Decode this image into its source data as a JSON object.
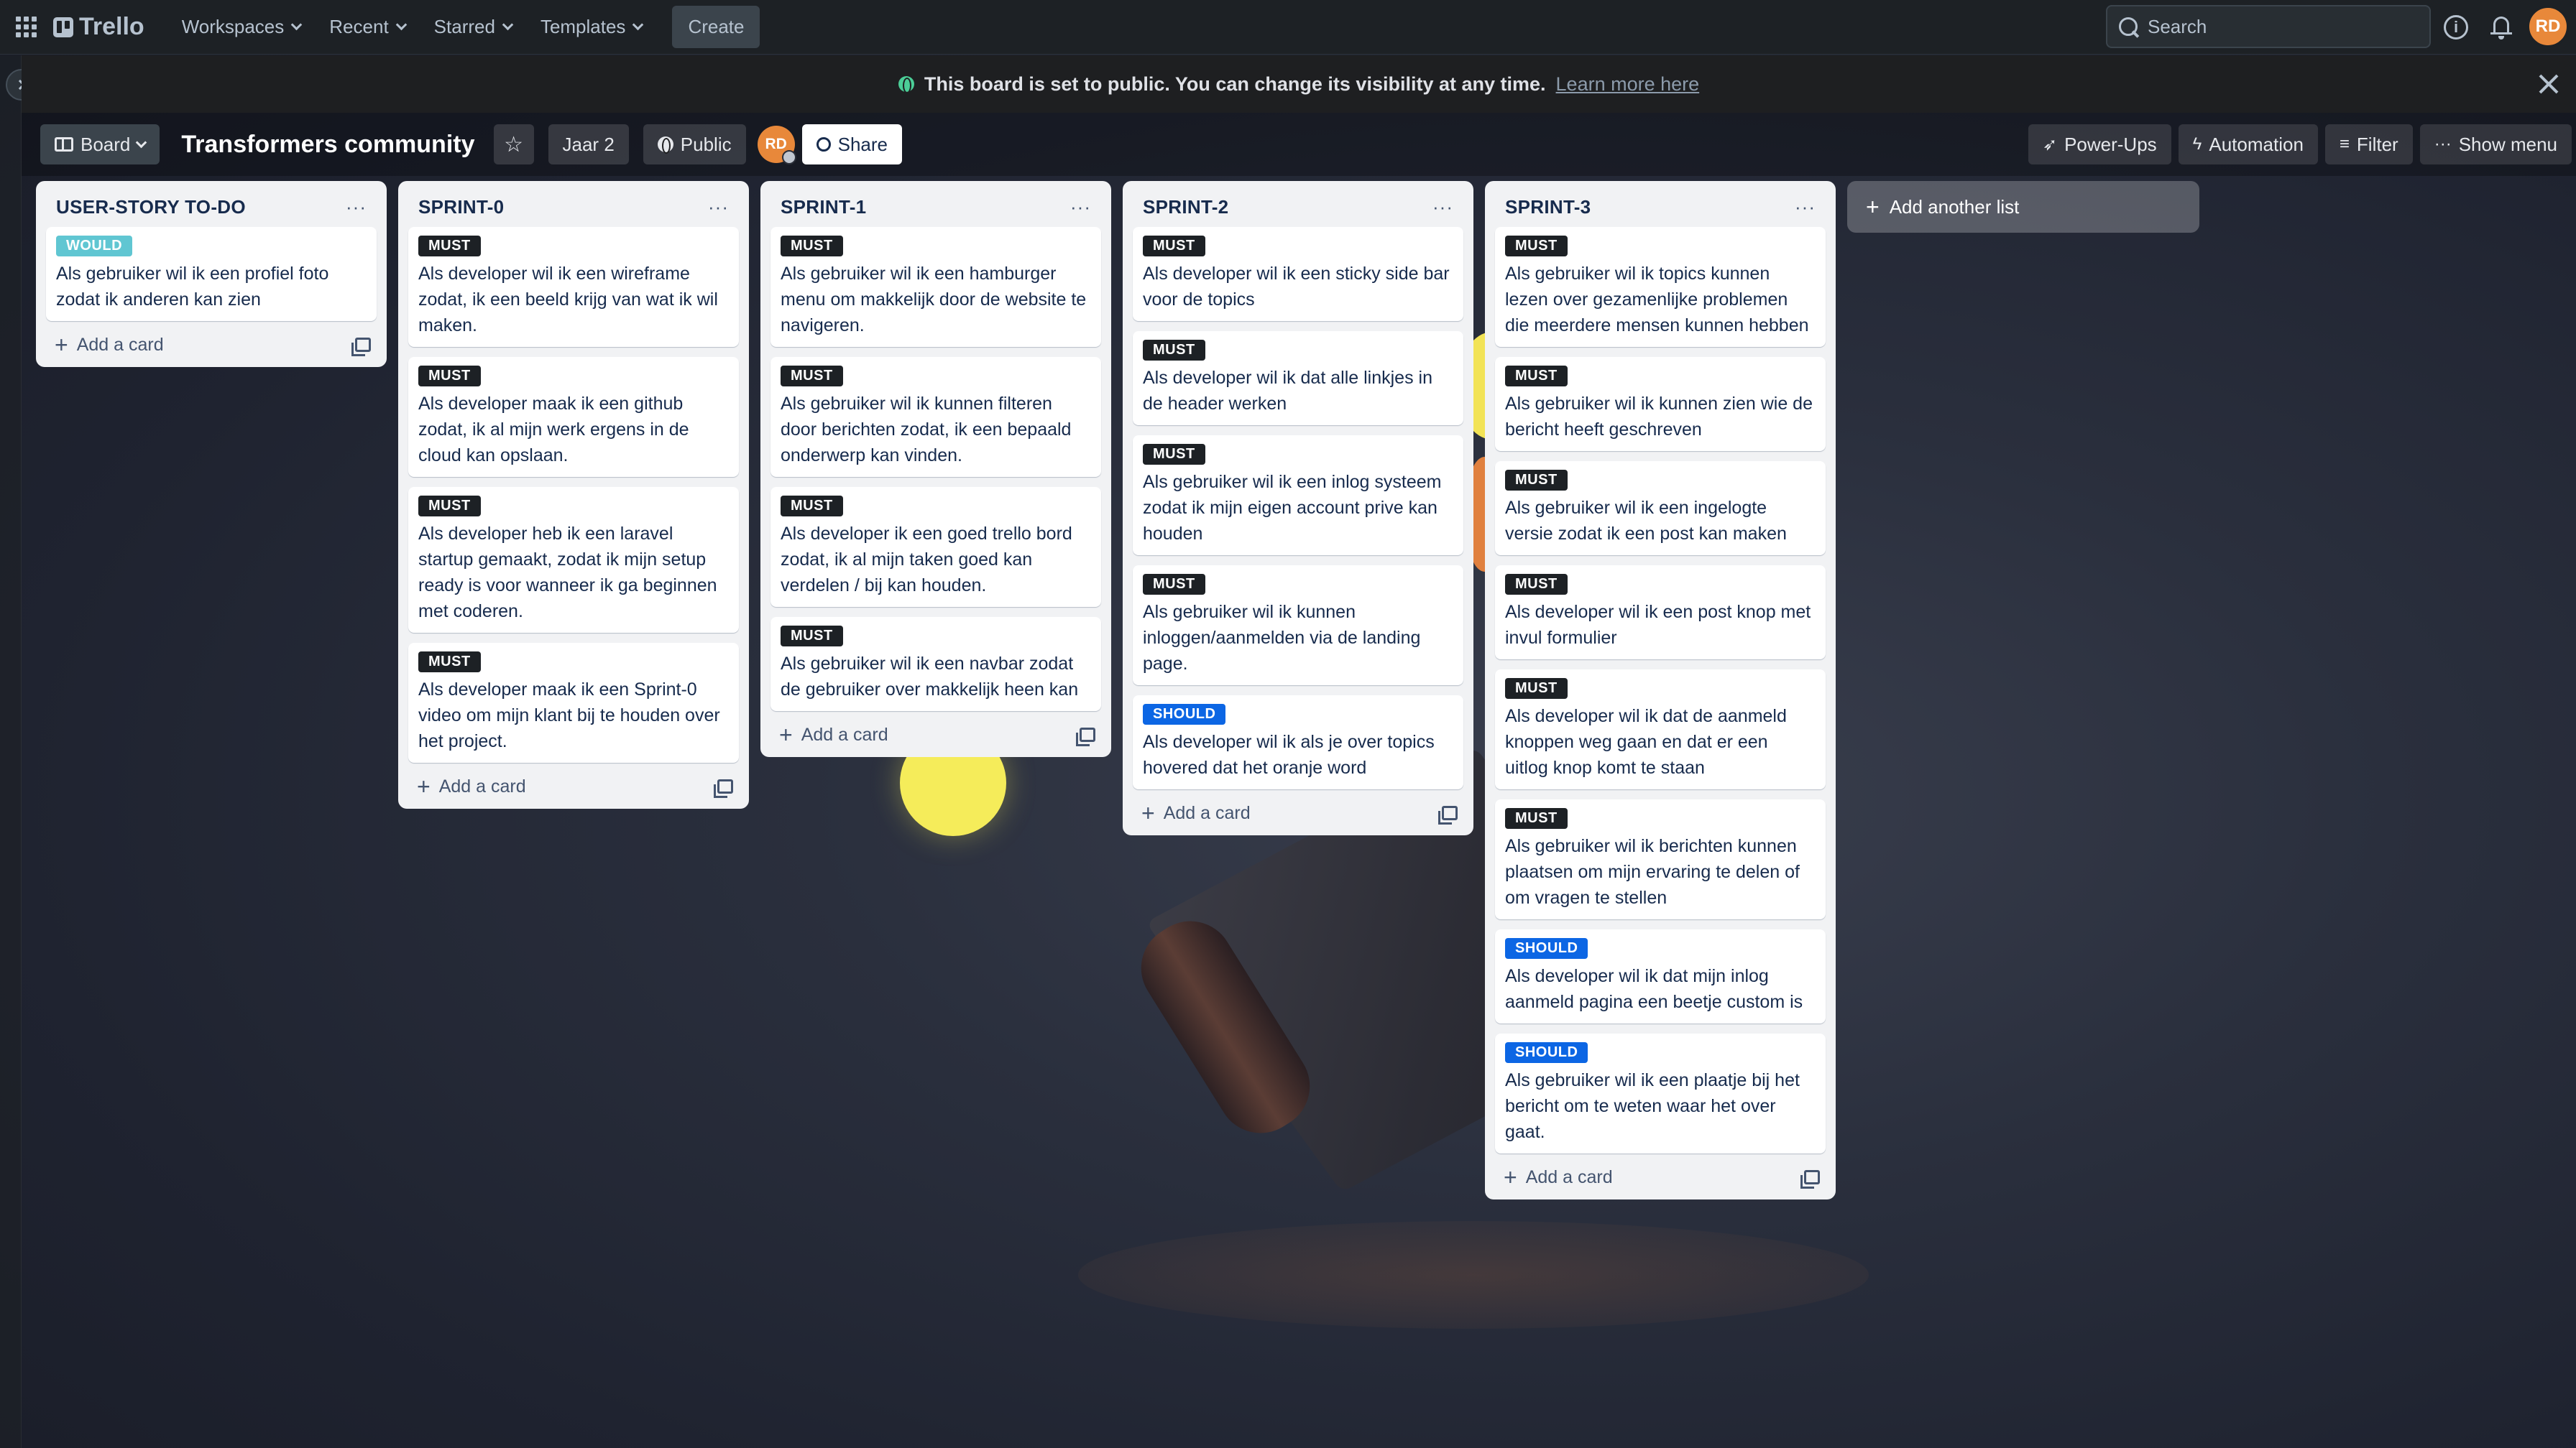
{
  "topnav": {
    "brand": "Trello",
    "menu": [
      {
        "label": "Workspaces"
      },
      {
        "label": "Recent"
      },
      {
        "label": "Starred"
      },
      {
        "label": "Templates"
      }
    ],
    "create_label": "Create",
    "search_placeholder": "Search",
    "avatar_initials": "RD"
  },
  "banner": {
    "text": "This board is set to public. You can change its visibility at any time.",
    "link": "Learn more here"
  },
  "board": {
    "view_label": "Board",
    "title": "Transformers community",
    "star_glyph": "☆",
    "tag": "Jaar 2",
    "visibility": "Public",
    "member_initials": "RD",
    "share_label": "Share",
    "right_buttons": {
      "powerups": "Power-Ups",
      "automation": "Automation",
      "filter": "Filter",
      "show_menu": "Show menu"
    }
  },
  "lists": [
    {
      "title": "USER-STORY TO-DO",
      "cards": [
        {
          "label": "WOULD",
          "priority": "would",
          "text": "Als gebruiker wil ik een profiel foto zodat ik anderen kan zien"
        }
      ]
    },
    {
      "title": "SPRINT-0",
      "cards": [
        {
          "label": "MUST",
          "priority": "must",
          "text": "Als developer wil ik een wireframe zodat, ik een beeld krijg van wat ik wil maken."
        },
        {
          "label": "MUST",
          "priority": "must",
          "text": "Als developer maak ik een github zodat, ik al mijn werk ergens in de cloud kan opslaan."
        },
        {
          "label": "MUST",
          "priority": "must",
          "text": "Als developer heb ik een laravel startup gemaakt, zodat ik mijn setup ready is voor wanneer ik ga beginnen met coderen."
        },
        {
          "label": "MUST",
          "priority": "must",
          "text": "Als developer maak ik een Sprint-0 video om mijn klant bij te houden over het project."
        }
      ]
    },
    {
      "title": "SPRINT-1",
      "cards": [
        {
          "label": "MUST",
          "priority": "must",
          "text": "Als gebruiker wil ik een hamburger menu om makkelijk door de website te navigeren."
        },
        {
          "label": "MUST",
          "priority": "must",
          "text": "Als gebruiker wil ik kunnen filteren door berichten zodat, ik een bepaald onderwerp kan vinden."
        },
        {
          "label": "MUST",
          "priority": "must",
          "text": "Als developer ik een goed trello bord zodat, ik al mijn taken goed kan verdelen / bij kan houden."
        },
        {
          "label": "MUST",
          "priority": "must",
          "text": "Als gebruiker wil ik een navbar zodat de gebruiker over makkelijk heen kan"
        }
      ]
    },
    {
      "title": "SPRINT-2",
      "cards": [
        {
          "label": "MUST",
          "priority": "must",
          "text": "Als developer wil ik een sticky side bar voor de topics"
        },
        {
          "label": "MUST",
          "priority": "must",
          "text": "Als developer wil ik dat alle linkjes in de header werken"
        },
        {
          "label": "MUST",
          "priority": "must",
          "text": "Als gebruiker wil ik een inlog systeem zodat ik mijn eigen account prive kan houden"
        },
        {
          "label": "MUST",
          "priority": "must",
          "text": "Als gebruiker wil ik kunnen inloggen/aanmelden via de landing page."
        },
        {
          "label": "SHOULD",
          "priority": "should",
          "text": "Als developer wil ik als je over topics hovered dat het oranje word"
        }
      ]
    },
    {
      "title": "SPRINT-3",
      "cards": [
        {
          "label": "MUST",
          "priority": "must",
          "text": "Als gebruiker wil ik topics kunnen lezen over gezamenlijke problemen die meerdere mensen kunnen hebben"
        },
        {
          "label": "MUST",
          "priority": "must",
          "text": "Als gebruiker wil ik kunnen zien wie de bericht heeft geschreven"
        },
        {
          "label": "MUST",
          "priority": "must",
          "text": "Als gebruiker wil ik een ingelogte versie zodat ik een post kan maken"
        },
        {
          "label": "MUST",
          "priority": "must",
          "text": "Als developer wil ik een post knop met invul formulier"
        },
        {
          "label": "MUST",
          "priority": "must",
          "text": "Als developer wil ik dat de aanmeld knoppen weg gaan en dat er een uitlog knop komt te staan"
        },
        {
          "label": "MUST",
          "priority": "must",
          "text": "Als gebruiker wil ik berichten kunnen plaatsen om mijn ervaring te delen of om vragen te stellen"
        },
        {
          "label": "SHOULD",
          "priority": "should",
          "text": "Als developer wil ik dat mijn inlog aanmeld pagina een beetje custom is"
        },
        {
          "label": "SHOULD",
          "priority": "should",
          "text": "Als gebruiker wil ik een plaatje bij het bericht om te weten waar het over gaat."
        }
      ]
    }
  ],
  "add_card_label": "Add a card",
  "add_list_label": "Add another list",
  "colors": {
    "must": "#1d2125",
    "should": "#0c66e4",
    "would": "#60c6d2",
    "avatar": "#e8883a"
  }
}
